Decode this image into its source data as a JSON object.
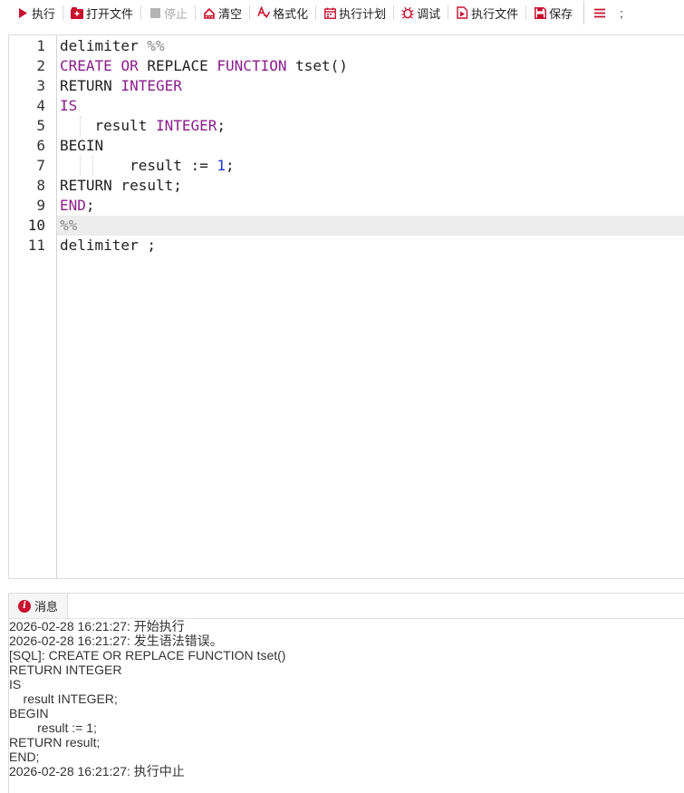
{
  "toolbar": {
    "run": "执行",
    "open_file": "打开文件",
    "stop": "停止",
    "clear": "清空",
    "format": "格式化",
    "explain_plan": "执行计划",
    "debug": "调试",
    "run_file": "执行文件",
    "save": "保存",
    "delimiter": ";"
  },
  "editor": {
    "active_line": 10,
    "lines": [
      {
        "n": "1",
        "segments": [
          {
            "t": "delimiter ",
            "c": "plain"
          },
          {
            "t": "%%",
            "c": "punc"
          }
        ]
      },
      {
        "n": "2",
        "segments": [
          {
            "t": "CREATE",
            "c": "kw"
          },
          {
            "t": " ",
            "c": "plain"
          },
          {
            "t": "OR",
            "c": "kw"
          },
          {
            "t": " REPLACE ",
            "c": "plain"
          },
          {
            "t": "FUNCTION",
            "c": "kw"
          },
          {
            "t": " tset()",
            "c": "plain"
          }
        ]
      },
      {
        "n": "3",
        "segments": [
          {
            "t": "RETURN ",
            "c": "plain"
          },
          {
            "t": "INTEGER",
            "c": "kw"
          }
        ]
      },
      {
        "n": "4",
        "segments": [
          {
            "t": "IS",
            "c": "kw"
          }
        ]
      },
      {
        "n": "5",
        "segments": [
          {
            "t": "    result ",
            "c": "plain"
          },
          {
            "t": "INTEGER",
            "c": "kw"
          },
          {
            "t": ";",
            "c": "plain"
          }
        ]
      },
      {
        "n": "6",
        "segments": [
          {
            "t": "BEGIN",
            "c": "plain"
          }
        ]
      },
      {
        "n": "7",
        "segments": [
          {
            "t": "        result := ",
            "c": "plain"
          },
          {
            "t": "1",
            "c": "num"
          },
          {
            "t": ";",
            "c": "plain"
          }
        ]
      },
      {
        "n": "8",
        "segments": [
          {
            "t": "RETURN result;",
            "c": "plain"
          }
        ]
      },
      {
        "n": "9",
        "segments": [
          {
            "t": "END",
            "c": "kw"
          },
          {
            "t": ";",
            "c": "plain"
          }
        ]
      },
      {
        "n": "10",
        "segments": [
          {
            "t": "%%",
            "c": "punc"
          }
        ]
      },
      {
        "n": "11",
        "segments": [
          {
            "t": "delimiter ;",
            "c": "plain"
          }
        ]
      }
    ]
  },
  "messages": {
    "tab_label": "消息",
    "lines": [
      "2026-02-28 16:21:27: 开始执行",
      "2026-02-28 16:21:27: 发生语法错误。",
      "[SQL]: CREATE OR REPLACE FUNCTION tset()",
      "RETURN INTEGER",
      "IS",
      "    result INTEGER;",
      "BEGIN",
      "        result := 1;",
      "RETURN result;",
      "END;",
      "2026-02-28 16:21:27: 执行中止"
    ]
  }
}
